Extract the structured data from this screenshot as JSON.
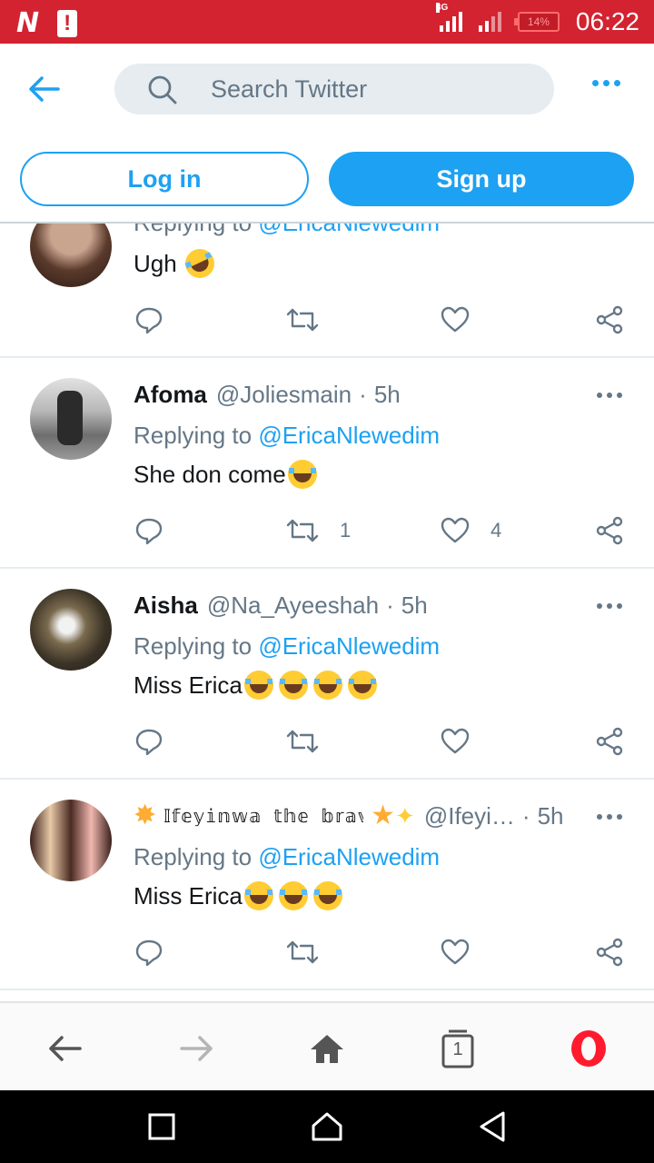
{
  "status_bar": {
    "time": "06:22",
    "network": "3G",
    "battery": "14%",
    "app_letter": "N",
    "alert_mark": "!",
    "accent_color": "#d32330"
  },
  "header": {
    "search_placeholder": "Search Twitter",
    "icons": [
      "back-arrow-icon",
      "search-icon",
      "more-icon"
    ],
    "accent_color": "#1da1f2"
  },
  "auth": {
    "login_label": "Log in",
    "signup_label": "Sign up"
  },
  "tweets": [
    {
      "replying_prefix": "Replying to",
      "replying_to": "@EricaNlewedim",
      "text": "Ugh",
      "emoji": [
        "rolling-on-floor-laughing"
      ],
      "retweets": "",
      "likes": ""
    },
    {
      "name": "Afoma",
      "handle": "@Joliesmain",
      "time": "5h",
      "replying_prefix": "Replying to",
      "replying_to": "@EricaNlewedim",
      "text": "She don come",
      "emoji": [
        "face-with-tears-of-joy"
      ],
      "retweets": "1",
      "likes": "4"
    },
    {
      "name": "Aisha",
      "handle": "@Na_Ayeeshah",
      "time": "5h",
      "replying_prefix": "Replying to",
      "replying_to": "@EricaNlewedim",
      "text": "Miss Erica",
      "emoji": [
        "face-with-tears-of-joy",
        "face-with-tears-of-joy",
        "face-with-tears-of-joy",
        "face-with-tears-of-joy"
      ],
      "retweets": "",
      "likes": ""
    },
    {
      "name": "𝕀𝕗𝕖𝕪𝕚𝕟𝕨𝕒 𝕥𝕙𝕖 𝕓𝕣𝕒𝕧𝕖",
      "handle": "@Ifeyi…",
      "time": "5h",
      "replying_prefix": "Replying to",
      "replying_to": "@EricaNlewedim",
      "text": "Miss Erica",
      "emoji": [
        "face-with-tears-of-joy",
        "face-with-tears-of-joy",
        "face-with-tears-of-joy"
      ],
      "retweets": "",
      "likes": ""
    }
  ],
  "browser_bar": {
    "tab_count": "1",
    "icons": [
      "back-icon",
      "forward-icon",
      "home-icon",
      "tabs-icon",
      "opera-icon"
    ],
    "opera_color": "#ff1b2d"
  },
  "nav_bar": {
    "icons": [
      "recents-icon",
      "home-icon",
      "back-icon"
    ]
  },
  "dot": "·"
}
